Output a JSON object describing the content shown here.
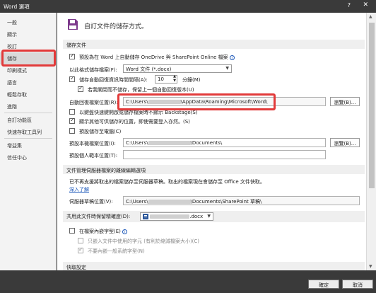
{
  "window": {
    "title": "Word 選項",
    "help_glyph": "?",
    "close_glyph": "✕"
  },
  "sidebar": {
    "items": [
      {
        "label": "一般"
      },
      {
        "label": "顯示"
      },
      {
        "label": "校訂"
      },
      {
        "label": "儲存",
        "active": true
      },
      {
        "label": "印刷樣式"
      },
      {
        "label": "語言"
      },
      {
        "label": "輕鬆存取"
      },
      {
        "label": "進階"
      },
      {
        "label": "自訂功能區"
      },
      {
        "label": "快速存取工具列"
      },
      {
        "label": "增益集"
      },
      {
        "label": "信任中心"
      }
    ]
  },
  "header": {
    "icon": "save-document-icon",
    "text": "自訂文件的儲存方式。"
  },
  "sections": {
    "save_docs": "儲存文件",
    "offline": "文件管理伺服器檔案的離線編輯選項",
    "fidelity": "共用此文件時保留精確度(D):",
    "cache": "快取設定"
  },
  "save": {
    "default_cloud": "預設為在 Word 上自動儲存 OneDrive 與 SharePoint Online 檔案",
    "format_label": "以此格式儲存檔案(F):",
    "format_value": "Word 文件 (*.docx)",
    "autorecover_label": "儲存自動回復資訊時間間隔(A):",
    "autorecover_minutes": "10",
    "minutes_unit": "分鐘(M)",
    "keep_last": "若我關閉而不儲存，保留上一個自動回復版本(U)",
    "autorecover_path_label": "自動回復檔案位置(R):",
    "autorecover_path_prefix": "C:\\Users\\",
    "autorecover_path_suffix": "\\AppData\\Roaming\\Microsoft\\Word\\",
    "browse": "瀏覽(B)...",
    "backstage": "以鍵盤快速鍵開啟或儲存檔案時不顯示 Backstage(S)",
    "other_locations": "顯示其他可供儲存的位置，即使需要登入亦然。(S)",
    "default_computer": "預設儲存至電腦(C)",
    "local_path_label": "預設本機檔案位置(I):",
    "local_path_prefix": "C:\\Users\\",
    "local_path_suffix": "\\Documents\\",
    "template_path_label": "預設個人範本位置(T):",
    "template_path_value": ""
  },
  "offline": {
    "text": "已不再支援將取出的檔案儲存至伺服器草稿。取出的檔案現在會儲存至 Office 文件快取。",
    "link": "深入了解",
    "drafts_label": "伺服器草稿位置(V):",
    "drafts_prefix": "C:\\Users\\",
    "drafts_suffix": "\\Documents\\SharePoint 草稿\\"
  },
  "fidelity": {
    "doc_suffix": ".docx",
    "embed_fonts": "在檔案內嵌字型(E)",
    "embed_subset": "只嵌入文件中使用的字元 (有利於縮減檔案大小)(C)",
    "no_common": "不要內嵌一般系統字型(N)"
  },
  "footer": {
    "ok": "確定",
    "cancel": "取消"
  },
  "colors": {
    "highlight": "#e23a3a",
    "link": "#1a56b8",
    "chrome": "#3a3a3a"
  }
}
